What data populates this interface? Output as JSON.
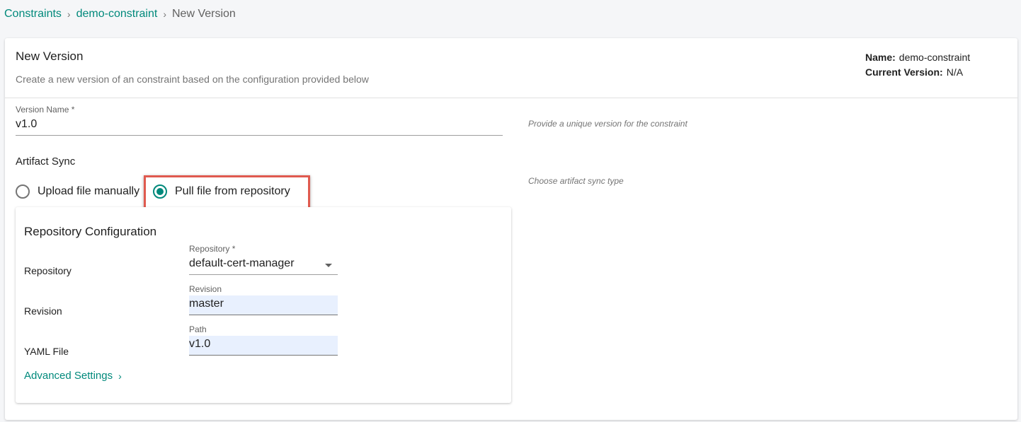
{
  "breadcrumb": {
    "items": [
      "Constraints",
      "demo-constraint"
    ],
    "current": "New Version",
    "separator": "›"
  },
  "header": {
    "title": "New Version",
    "subtitle": "Create a new version of an constraint based on the configuration provided below",
    "name_label": "Name:",
    "name_value": "demo-constraint",
    "version_label": "Current Version:",
    "version_value": "N/A"
  },
  "version_field": {
    "label": "Version Name *",
    "value": "v1.0",
    "hint": "Provide a unique version for the constraint"
  },
  "artifact_sync": {
    "title": "Artifact Sync",
    "hint": "Choose artifact sync type",
    "options": [
      {
        "label": "Upload file manually",
        "selected": false
      },
      {
        "label": "Pull file from repository",
        "selected": true
      }
    ]
  },
  "repo_config": {
    "title": "Repository Configuration",
    "repository": {
      "row_label": "Repository",
      "field_label": "Repository *",
      "value": "default-cert-manager"
    },
    "revision": {
      "row_label": "Revision",
      "field_label": "Revision",
      "value": "master"
    },
    "path": {
      "row_label": "YAML File",
      "field_label": "Path",
      "value": "v1.0"
    },
    "advanced_label": "Advanced Settings",
    "advanced_chevron": "›"
  },
  "colors": {
    "accent": "#00897b",
    "highlight": "#e05a4f",
    "input_fill": "#e8f0fe"
  }
}
